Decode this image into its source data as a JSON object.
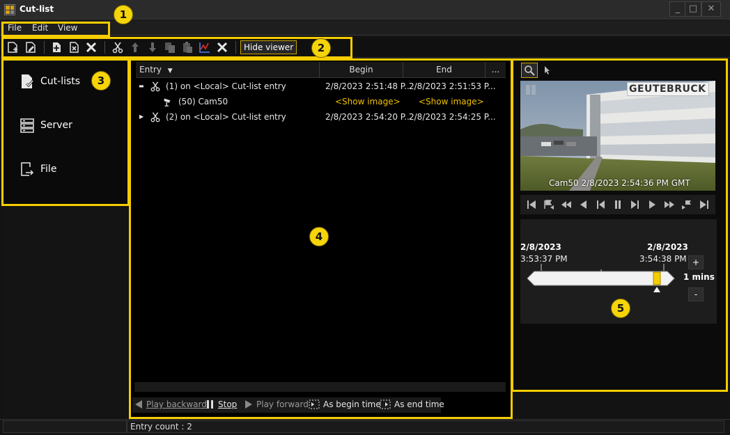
{
  "window": {
    "title": "Cut-list",
    "minimize": "_",
    "maximize": "□",
    "close": "✕"
  },
  "menu": {
    "items": [
      "File",
      "Edit",
      "View"
    ]
  },
  "toolbar": {
    "hide_viewer": "Hide viewer"
  },
  "callouts": [
    "1",
    "2",
    "3",
    "4",
    "5"
  ],
  "nav": {
    "items": [
      {
        "label": "Cut-lists",
        "icon": "cutlist-doc-icon"
      },
      {
        "label": "Server",
        "icon": "server-icon"
      },
      {
        "label": "File",
        "icon": "file-export-icon"
      }
    ]
  },
  "list": {
    "columns": {
      "entry": "Entry",
      "begin": "Begin",
      "end": "End",
      "more": "..."
    },
    "rows": [
      {
        "entry": "(1) on <Local>   Cut-list entry",
        "begin": "2/8/2023 2:51:48 P...",
        "end": "2/8/2023 2:51:53 P..."
      },
      {
        "entry": "(50) Cam50",
        "begin": "<Show image>",
        "end": "<Show image>"
      },
      {
        "entry": "(2) on <Local>   Cut-list entry",
        "begin": "2/8/2023 2:54:20 P...",
        "end": "2/8/2023 2:54:25 P..."
      }
    ]
  },
  "playback": {
    "play_backward": "Play backward",
    "stop": "Stop",
    "play_forward": "Play forward",
    "as_begin_time": "As begin time",
    "as_end_time": "As end time"
  },
  "viewer": {
    "brand": "GEUTEBRUCK",
    "caption": "Cam50  2/8/2023 2:54:36 PM GMT",
    "timeline": {
      "left_date": "2/8/2023",
      "left_time": "3:53:37 PM",
      "right_date": "2/8/2023",
      "right_time": "3:54:38 PM",
      "zoom_in": "+",
      "zoom_label": "1 mins",
      "zoom_out": "-"
    }
  },
  "status": {
    "entry_count": "Entry count : 2"
  },
  "colors": {
    "accent": "#f5cd00",
    "link": "#f0c000"
  }
}
